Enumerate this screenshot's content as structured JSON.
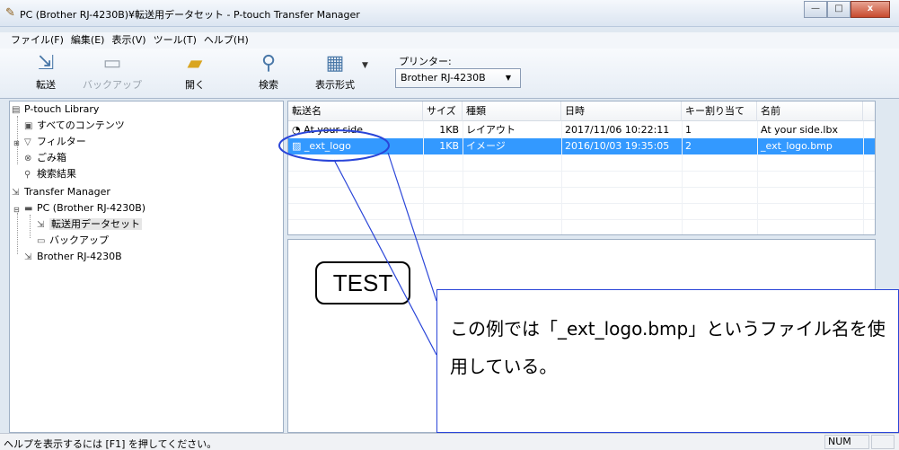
{
  "window": {
    "title": "PC (Brother RJ-4230B)¥転送用データセット - P-touch Transfer Manager",
    "minimize": "—",
    "maximize": "□",
    "close": "x"
  },
  "menu": [
    "ファイル(F)",
    "編集(E)",
    "表示(V)",
    "ツール(T)",
    "ヘルプ(H)"
  ],
  "toolbar": {
    "transfer": "転送",
    "backup": "バックアップ",
    "open": "開く",
    "search": "検索",
    "view_mode": "表示形式",
    "printer_label": "プリンター:",
    "printer_value": "Brother RJ-4230B"
  },
  "tree": {
    "library": "P-touch Library",
    "all_contents": "すべてのコンテンツ",
    "filter": "フィルター",
    "trash": "ごみ箱",
    "search_results": "検索結果",
    "transfer_manager": "Transfer Manager",
    "pc": "PC (Brother RJ-4230B)",
    "dataset": "転送用データセット",
    "backup": "バックアップ",
    "printer": "Brother RJ-4230B"
  },
  "table": {
    "headers": [
      "転送名",
      "サイズ",
      "種類",
      "日時",
      "キー割り当て",
      "名前"
    ],
    "rows": [
      {
        "name": "At your side",
        "size": "1KB",
        "type": "レイアウト",
        "date": "2017/11/06 10:22:11",
        "key": "1",
        "file": "At your side.lbx"
      },
      {
        "name": "_ext_logo",
        "size": "1KB",
        "type": "イメージ",
        "date": "2016/10/03 19:35:05",
        "key": "2",
        "file": "_ext_logo.bmp"
      }
    ],
    "selected_row": 1
  },
  "preview": {
    "label_text": "TEST"
  },
  "callout": {
    "text": "この例では「_ext_logo.bmp」というファイル名を使用している。",
    "color": "#2a45d8"
  },
  "status": {
    "help": "ヘルプを表示するには [F1] を押してください。",
    "num": "NUM"
  },
  "colors": {
    "selection": "#3399ff",
    "annotation": "#2a45d8"
  }
}
